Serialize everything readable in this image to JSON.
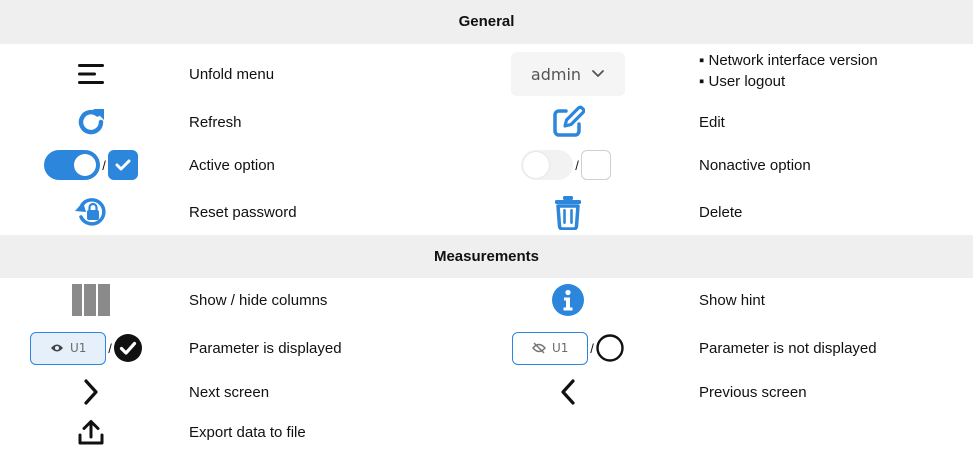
{
  "colors": {
    "accent": "#2b86dc",
    "header_bg": "#efefef",
    "text": "#111111"
  },
  "sections": {
    "general": "General",
    "measurements": "Measurements"
  },
  "general": {
    "unfold_menu": {
      "icon": "hamburger-icon",
      "label": "Unfold menu"
    },
    "admin": {
      "value": "admin",
      "icon": "chevron-down-icon",
      "bullets": [
        "▪ Network interface version",
        "▪ User logout"
      ]
    },
    "refresh": {
      "icon": "refresh-icon",
      "label": "Refresh"
    },
    "edit": {
      "icon": "edit-icon",
      "label": "Edit"
    },
    "active_option": {
      "separator": "/",
      "label": "Active option"
    },
    "nonactive_option": {
      "separator": "/",
      "label": "Nonactive option"
    },
    "reset_password": {
      "icon": "reset-password-icon",
      "label": "Reset password"
    },
    "delete": {
      "icon": "trash-icon",
      "label": "Delete"
    }
  },
  "measurements": {
    "columns": {
      "icon": "columns-icon",
      "label": "Show / hide columns"
    },
    "hint": {
      "icon": "info-icon",
      "label": "Show hint"
    },
    "displayed": {
      "chip": "U1",
      "separator": "/",
      "label": "Parameter is displayed"
    },
    "not_displayed": {
      "chip": "U1",
      "separator": "/",
      "label": "Parameter is not displayed"
    },
    "next": {
      "icon": "chevron-right-icon",
      "label": "Next screen"
    },
    "previous": {
      "icon": "chevron-left-icon",
      "label": "Previous screen"
    },
    "export": {
      "icon": "upload-icon",
      "label": "Export data to file"
    }
  }
}
